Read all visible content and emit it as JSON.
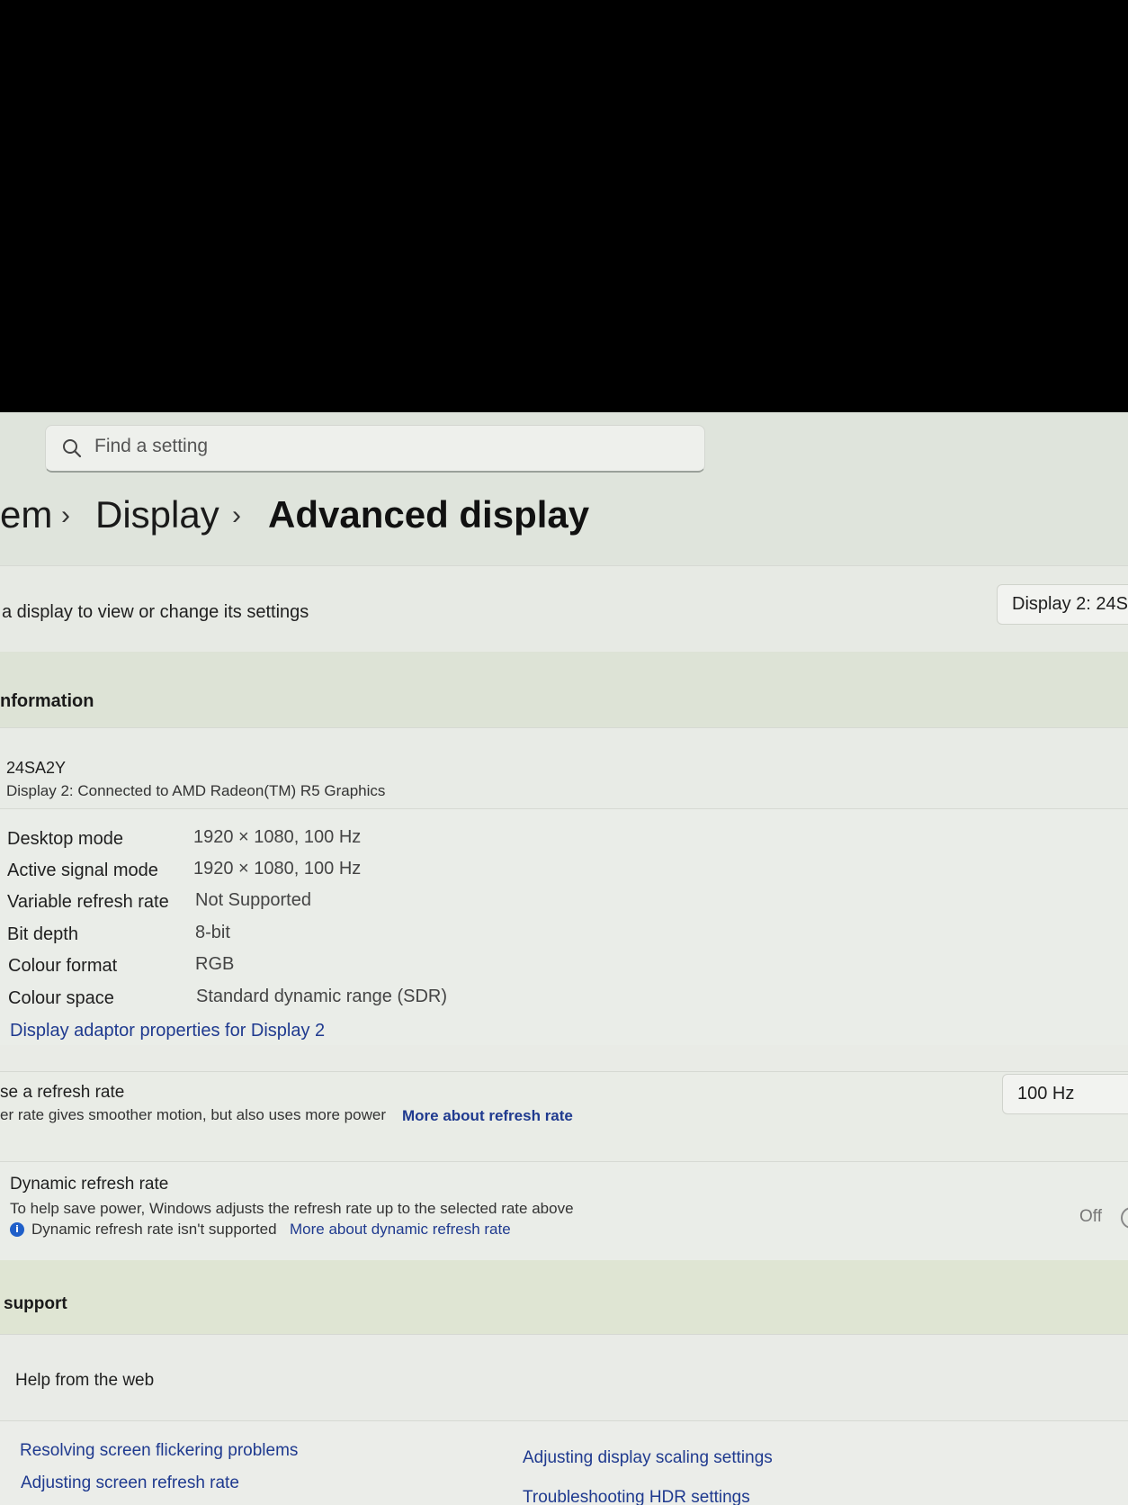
{
  "search": {
    "placeholder": "Find a setting"
  },
  "breadcrumb": {
    "item1": "em",
    "item2": "Display",
    "current": "Advanced display",
    "separator": "›"
  },
  "select_display": {
    "label": "a display to view or change its settings",
    "value": "Display 2: 24S"
  },
  "info_section": {
    "heading": "nformation",
    "monitor_name": "24SA2Y",
    "connection": "Display 2: Connected to AMD Radeon(TM) R5 Graphics",
    "rows": [
      {
        "label": "Desktop mode",
        "value": "1920 × 1080, 100 Hz"
      },
      {
        "label": "Active signal mode",
        "value": "1920 × 1080, 100 Hz"
      },
      {
        "label": "Variable refresh rate",
        "value": "Not Supported"
      },
      {
        "label": "Bit depth",
        "value": "8-bit"
      },
      {
        "label": "Colour format",
        "value": "RGB"
      },
      {
        "label": "Colour space",
        "value": "Standard dynamic range (SDR)"
      }
    ],
    "adapter_link": "Display adaptor properties for Display 2"
  },
  "refresh": {
    "title": "se a refresh rate",
    "desc": "er rate gives smoother motion, but also uses more power",
    "link": "More about refresh rate",
    "value": "100 Hz"
  },
  "dynamic": {
    "title": "Dynamic refresh rate",
    "desc": "To help save power, Windows adjusts the refresh rate up to the selected rate above",
    "note": "Dynamic refresh rate isn't supported",
    "link": "More about dynamic refresh rate",
    "toggle_state": "Off",
    "info_glyph": "i"
  },
  "support": {
    "heading": "support",
    "help_title": "Help from the web",
    "links": [
      "Resolving screen flickering problems",
      "Adjusting screen refresh rate",
      "Adjusting display scaling settings",
      "Troubleshooting HDR settings"
    ]
  }
}
